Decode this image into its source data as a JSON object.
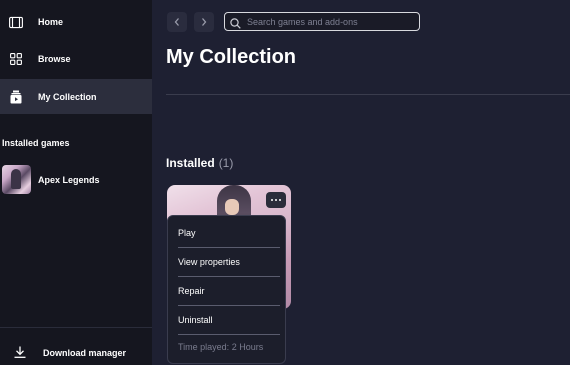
{
  "sidebar": {
    "nav": [
      {
        "label": "Home",
        "icon": "window-icon"
      },
      {
        "label": "Browse",
        "icon": "grid-icon"
      },
      {
        "label": "My Collection",
        "icon": "collection-icon"
      }
    ],
    "installed_section_title": "Installed games",
    "installed_games": [
      {
        "label": "Apex Legends"
      }
    ],
    "download_manager_label": "Download manager"
  },
  "header": {
    "search_placeholder": "Search games and add-ons"
  },
  "main": {
    "title": "My Collection",
    "installed_heading": "Installed",
    "installed_count": "(1)"
  },
  "context_menu": {
    "items": [
      "Play",
      "View properties",
      "Repair",
      "Uninstall"
    ],
    "footer": "Time played: 2 Hours"
  },
  "colors": {
    "background": "#1e2032",
    "sidebar": "#15161f",
    "active_nav": "#2c2e3d"
  }
}
